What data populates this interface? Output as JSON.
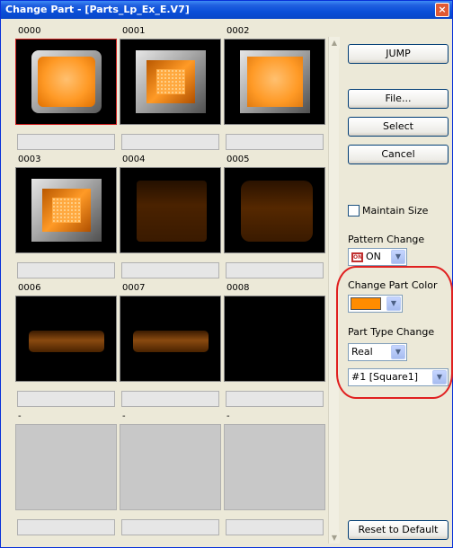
{
  "window": {
    "title": "Change Part - [Parts_Lp_Ex_E.V7]",
    "close_glyph": "×"
  },
  "parts": [
    {
      "id": "0000",
      "style": "round-frame",
      "selected": true
    },
    {
      "id": "0001",
      "style": "bevel-dots"
    },
    {
      "id": "0002",
      "style": "bevel-square"
    },
    {
      "id": "0003",
      "style": "bevel-dots"
    },
    {
      "id": "0004",
      "style": "dim-rect"
    },
    {
      "id": "0005",
      "style": "dim-round"
    },
    {
      "id": "0006",
      "style": "dim-bar"
    },
    {
      "id": "0007",
      "style": "dim-bar"
    },
    {
      "id": "0008",
      "style": "black"
    },
    {
      "id": "----",
      "style": "empty"
    },
    {
      "id": "----",
      "style": "empty"
    },
    {
      "id": "----",
      "style": "empty"
    }
  ],
  "buttons": {
    "jump": "JUMP",
    "file": "File...",
    "select": "Select",
    "cancel": "Cancel",
    "reset": "Reset to Default"
  },
  "options": {
    "maintain_size": {
      "label": "Maintain Size",
      "checked": false
    },
    "pattern_change": {
      "label": "Pattern Change",
      "badge": "ON",
      "value": "ON"
    },
    "change_part_color": {
      "label": "Change Part Color",
      "color": "#ff8c00"
    },
    "part_type_change": {
      "label": "Part Type Change",
      "value": "Real"
    },
    "shape": {
      "value": "#1 [Square1]"
    }
  },
  "colors": {
    "title_bar": "#0a4fd8",
    "highlight_ellipse": "#e02020",
    "part_color": "#ff8c00"
  }
}
